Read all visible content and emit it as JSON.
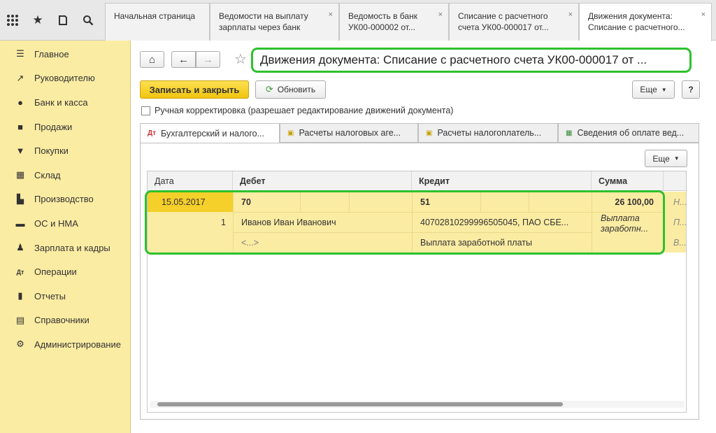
{
  "topbar": {
    "icons": [
      "apps-grid-icon",
      "star-icon",
      "history-icon",
      "search-icon"
    ],
    "tabs": [
      {
        "label": "Начальная страница"
      },
      {
        "label": "Ведомости на выплату зарплаты через банк",
        "close": "×"
      },
      {
        "label": "Ведомость в банк УК00-000002 от...",
        "close": "×"
      },
      {
        "label": "Списание с расчетного счета УК00-000017 от...",
        "close": "×"
      },
      {
        "label": "Движения документа: Списание с расчетного...",
        "close": "×"
      }
    ]
  },
  "sidebar": {
    "items": [
      {
        "label": "Главное",
        "icon": "menu-lines-icon"
      },
      {
        "label": "Руководителю",
        "icon": "trend-line-icon"
      },
      {
        "label": "Банк и касса",
        "icon": "ruble-coin-icon"
      },
      {
        "label": "Продажи",
        "icon": "shopping-bag-icon"
      },
      {
        "label": "Покупки",
        "icon": "cart-icon"
      },
      {
        "label": "Склад",
        "icon": "warehouse-icon"
      },
      {
        "label": "Производство",
        "icon": "factory-icon"
      },
      {
        "label": "ОС и НМА",
        "icon": "truck-icon"
      },
      {
        "label": "Зарплата и кадры",
        "icon": "person-icon"
      },
      {
        "label": "Операции",
        "icon": "dt-kt-icon"
      },
      {
        "label": "Отчеты",
        "icon": "bar-chart-icon"
      },
      {
        "label": "Справочники",
        "icon": "book-icon"
      },
      {
        "label": "Администрирование",
        "icon": "gear-icon"
      }
    ]
  },
  "toolbar": {
    "home": "⌂",
    "back": "←",
    "forward": "→",
    "title": "Движения документа: Списание с расчетного счета УК00-000017 от ...",
    "save_close": "Записать и закрыть",
    "refresh": "Обновить",
    "more": "Еще",
    "help": "?",
    "manual_edit": "Ручная корректировка (разрешает редактирование движений документа)"
  },
  "subtabs": [
    {
      "label": "Бухгалтерский и налого..."
    },
    {
      "label": "Расчеты налоговых аге..."
    },
    {
      "label": "Расчеты налогоплатель..."
    },
    {
      "label": "Сведения об оплате вед..."
    }
  ],
  "grid": {
    "more": "Еще",
    "columns": [
      "Дата",
      "Дебет",
      "Кредит",
      "Сумма"
    ],
    "row": {
      "date": "15.05.2017",
      "number": "1",
      "debit_account": "70",
      "debit_sub1": "Иванов Иван Иванович",
      "debit_sub2": "<...>",
      "credit_account": "51",
      "credit_sub1": "40702810299996505045, ПАО СБЕ...",
      "credit_sub2": "Выплата заработной платы",
      "sum": "26 100,00",
      "content": "Выплата заработн...",
      "extra1": "Н...",
      "extra2": "П...",
      "extra3": "В..."
    }
  }
}
